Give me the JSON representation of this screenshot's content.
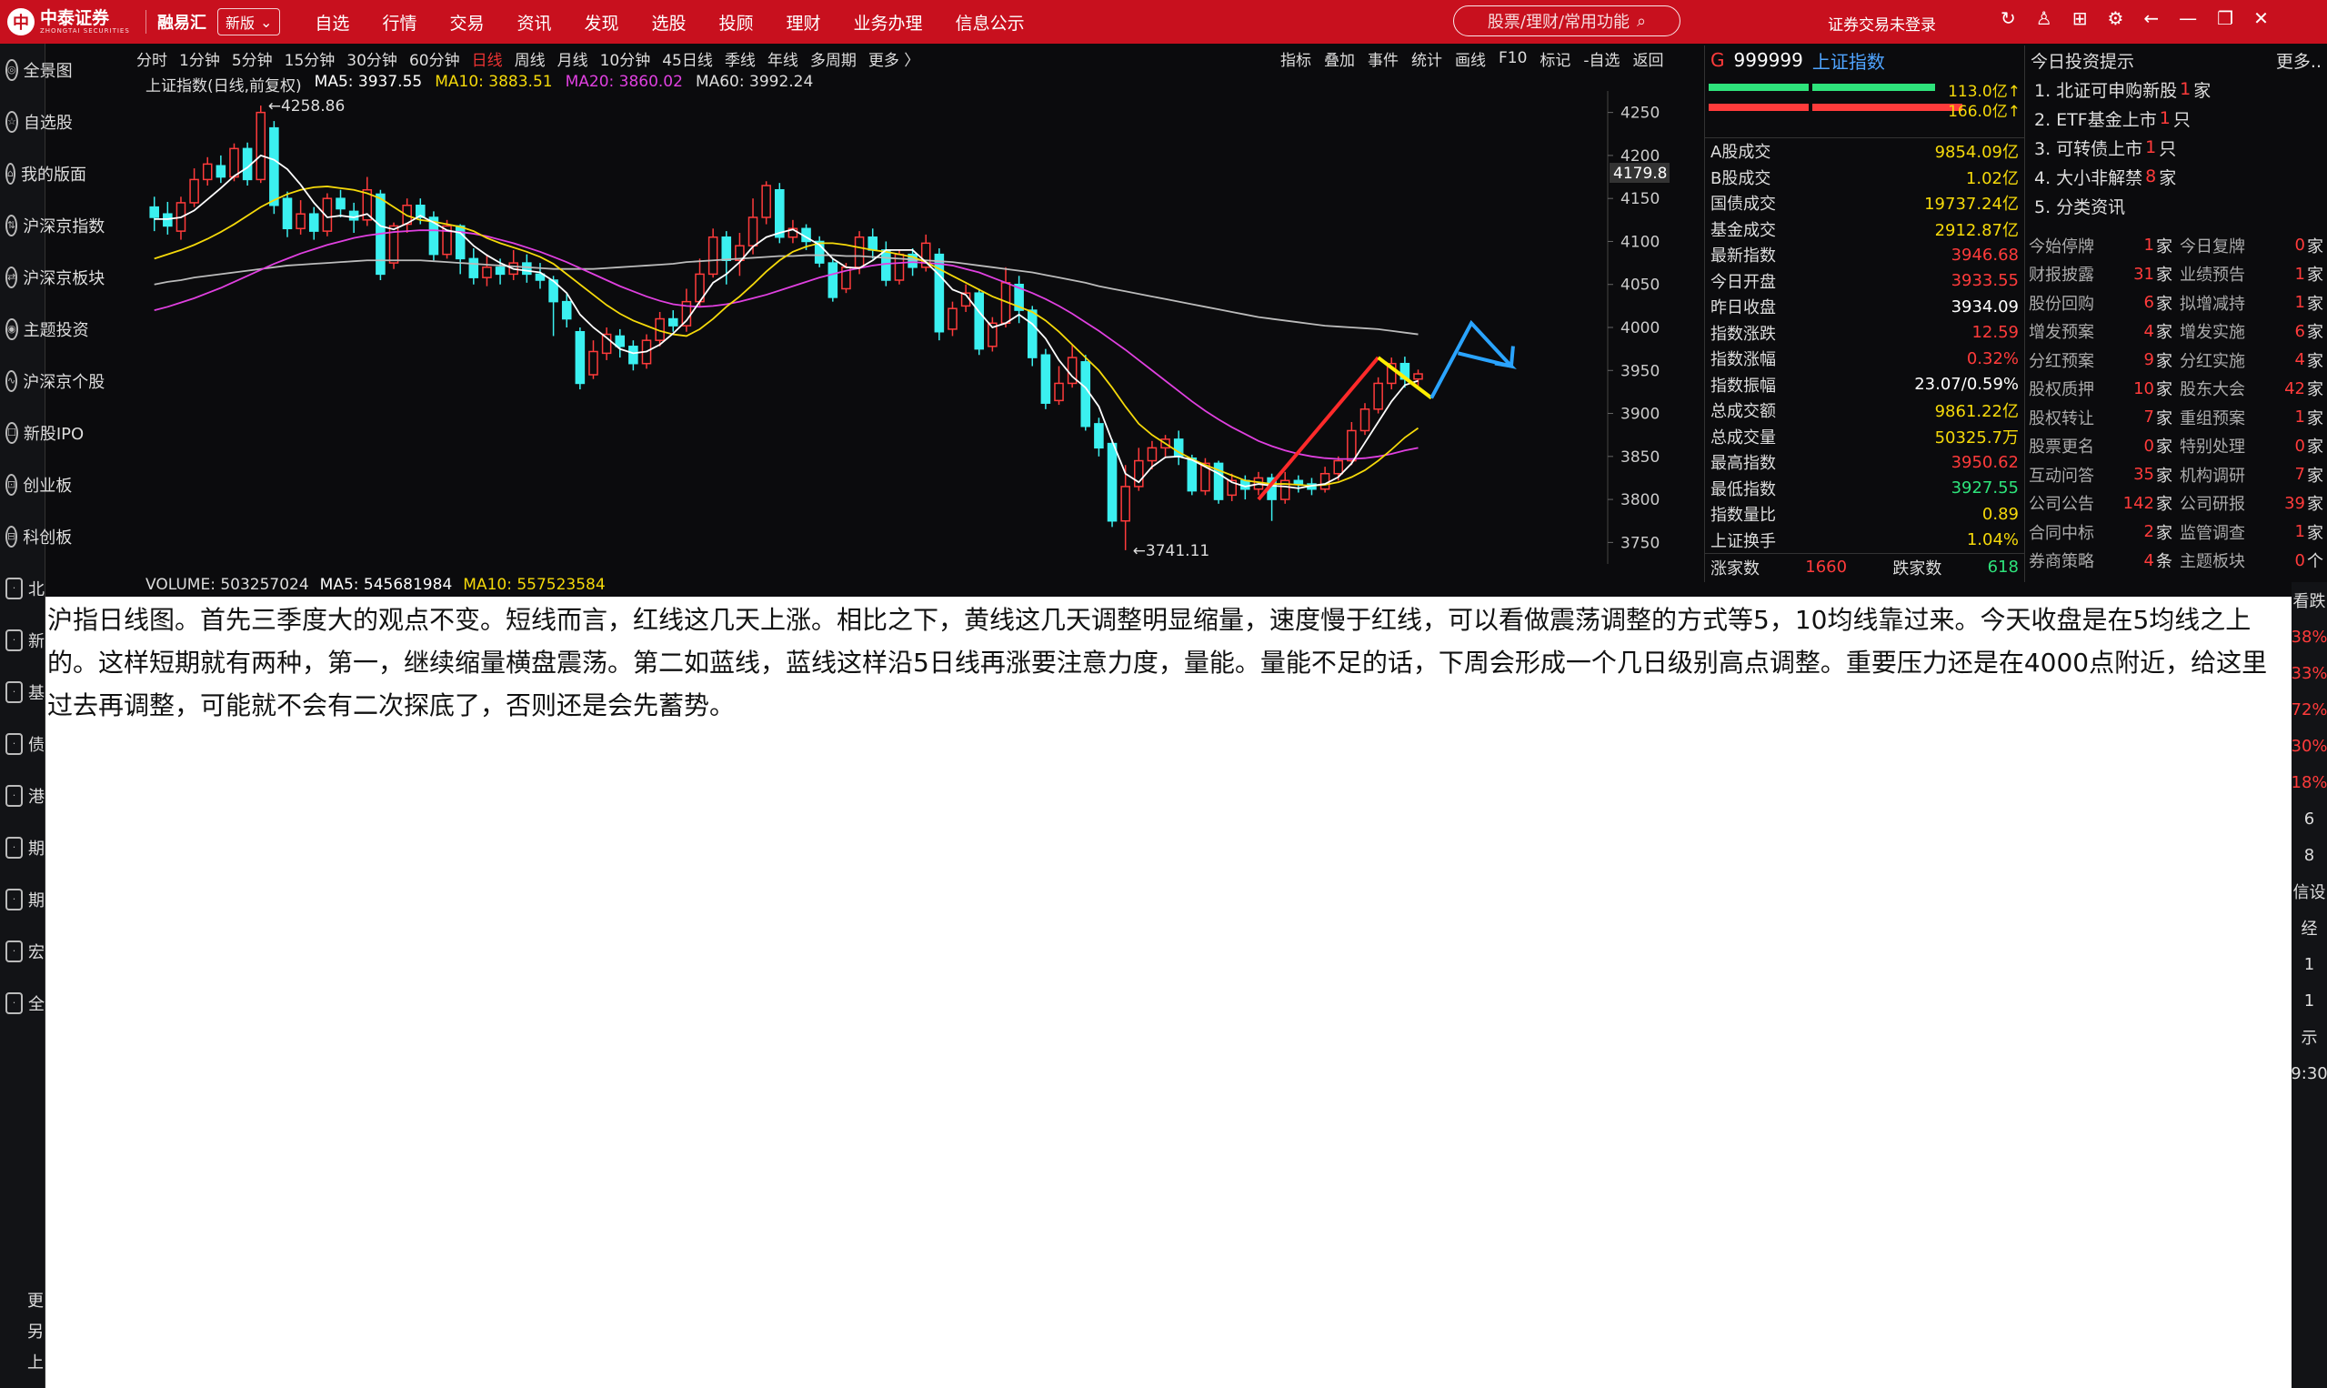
{
  "header": {
    "logo_mark": "中",
    "logo_name": "中泰证券",
    "logo_sub": "ZHONGTAI SECURITIES",
    "brand2": "融易汇",
    "version_label": "新版",
    "menu": [
      "自选",
      "行情",
      "交易",
      "资讯",
      "发现",
      "选股",
      "投顾",
      "理财",
      "业务办理",
      "信息公示"
    ],
    "search_placeholder": "股票/理财/常用功能",
    "login": "证券交易未登录",
    "accent": "#c8101e"
  },
  "sidebar": {
    "items": [
      "全景图",
      "自选股",
      "我的版面",
      "沪深京指数",
      "沪深京板块",
      "主题投资",
      "沪深京个股",
      "新股IPO",
      "创业板",
      "科创板"
    ],
    "extra": [
      "北",
      "新",
      "基",
      "债",
      "港",
      "期",
      "期",
      "宏",
      "全"
    ],
    "bottom": [
      "更",
      "另",
      "上"
    ]
  },
  "toolbar": {
    "periods": [
      "分时",
      "1分钟",
      "5分钟",
      "15分钟",
      "30分钟",
      "60分钟",
      "日线",
      "周线",
      "月线",
      "10分钟",
      "45日线",
      "季线",
      "年线",
      "多周期",
      "更多 〉"
    ],
    "active_period": "日线",
    "tools": [
      "指标",
      "叠加",
      "事件",
      "统计",
      "画线",
      "F10",
      "标记",
      "-自选",
      "返回"
    ]
  },
  "chart_title": {
    "name": "上证指数(日线,前复权)",
    "ma5": "MA5: 3937.55",
    "ma10": "MA10: 3883.51",
    "ma20": "MA20: 3860.02",
    "ma60": "MA60: 3992.24"
  },
  "chart_data": {
    "type": "candlestick",
    "ylim": [
      3725,
      4275
    ],
    "yticks": [
      4250,
      4200,
      4150,
      4100,
      4050,
      4000,
      3950,
      3900,
      3850,
      3800,
      3750
    ],
    "price_marker": "4179.8",
    "high_label": "←4258.86",
    "low_label": "←3741.11",
    "candles": [
      [
        4140,
        4128,
        4152,
        4112
      ],
      [
        4132,
        4118,
        4146,
        4108
      ],
      [
        4112,
        4145,
        4152,
        4102
      ],
      [
        4145,
        4172,
        4185,
        4140
      ],
      [
        4172,
        4190,
        4198,
        4165
      ],
      [
        4188,
        4175,
        4200,
        4168
      ],
      [
        4175,
        4208,
        4214,
        4170
      ],
      [
        4208,
        4172,
        4215,
        4165
      ],
      [
        4172,
        4250,
        4258,
        4168
      ],
      [
        4232,
        4142,
        4240,
        4132
      ],
      [
        4150,
        4115,
        4158,
        4105
      ],
      [
        4115,
        4132,
        4148,
        4108
      ],
      [
        4132,
        4112,
        4140,
        4102
      ],
      [
        4112,
        4150,
        4156,
        4106
      ],
      [
        4150,
        4138,
        4160,
        4128
      ],
      [
        4135,
        4125,
        4145,
        4110
      ],
      [
        4125,
        4160,
        4175,
        4118
      ],
      [
        4155,
        4062,
        4160,
        4055
      ],
      [
        4075,
        4118,
        4122,
        4068
      ],
      [
        4120,
        4142,
        4150,
        4110
      ],
      [
        4142,
        4128,
        4150,
        4120
      ],
      [
        4128,
        4085,
        4135,
        4078
      ],
      [
        4085,
        4118,
        4125,
        4080
      ],
      [
        4118,
        4080,
        4120,
        4062
      ],
      [
        4080,
        4058,
        4092,
        4050
      ],
      [
        4058,
        4070,
        4085,
        4048
      ],
      [
        4070,
        4062,
        4080,
        4050
      ],
      [
        4062,
        4075,
        4090,
        4055
      ],
      [
        4075,
        4062,
        4085,
        4052
      ],
      [
        4062,
        4055,
        4075,
        4045
      ],
      [
        4055,
        4030,
        4060,
        3990
      ],
      [
        4030,
        4010,
        4040,
        4000
      ],
      [
        3995,
        3935,
        4000,
        3928
      ],
      [
        3945,
        3972,
        3985,
        3940
      ],
      [
        3970,
        3992,
        4000,
        3962
      ],
      [
        3990,
        3978,
        3998,
        3965
      ],
      [
        3978,
        3958,
        3985,
        3950
      ],
      [
        3958,
        3985,
        3992,
        3952
      ],
      [
        3985,
        4010,
        4018,
        3978
      ],
      [
        4010,
        4002,
        4020,
        3995
      ],
      [
        4002,
        4030,
        4045,
        3995
      ],
      [
        4030,
        4062,
        4080,
        4025
      ],
      [
        4062,
        4105,
        4115,
        4058
      ],
      [
        4105,
        4078,
        4112,
        4050
      ],
      [
        4078,
        4095,
        4110,
        4060
      ],
      [
        4095,
        4128,
        4150,
        4085
      ],
      [
        4128,
        4165,
        4170,
        4120
      ],
      [
        4160,
        4105,
        4168,
        4098
      ],
      [
        4105,
        4115,
        4125,
        4098
      ],
      [
        4115,
        4100,
        4120,
        4090
      ],
      [
        4100,
        4075,
        4106,
        4070
      ],
      [
        4075,
        4035,
        4080,
        4030
      ],
      [
        4045,
        4070,
        4075,
        4040
      ],
      [
        4070,
        4105,
        4112,
        4062
      ],
      [
        4105,
        4090,
        4115,
        4080
      ],
      [
        4090,
        4055,
        4100,
        4048
      ],
      [
        4055,
        4085,
        4090,
        4050
      ],
      [
        4085,
        4070,
        4092,
        4060
      ],
      [
        4070,
        4098,
        4108,
        4065
      ],
      [
        4085,
        3995,
        4092,
        3985
      ],
      [
        3998,
        4022,
        4030,
        3990
      ],
      [
        4025,
        4040,
        4050,
        4018
      ],
      [
        4040,
        3975,
        4045,
        3968
      ],
      [
        3978,
        4005,
        4012,
        3972
      ],
      [
        4005,
        4052,
        4070,
        4000
      ],
      [
        4050,
        4020,
        4060,
        4005
      ],
      [
        4020,
        3965,
        4025,
        3955
      ],
      [
        3968,
        3912,
        3975,
        3905
      ],
      [
        3915,
        3935,
        3955,
        3910
      ],
      [
        3935,
        3965,
        3980,
        3930
      ],
      [
        3960,
        3885,
        3968,
        3880
      ],
      [
        3888,
        3860,
        3895,
        3850
      ],
      [
        3865,
        3775,
        3870,
        3768
      ],
      [
        3775,
        3815,
        3840,
        3741
      ],
      [
        3815,
        3845,
        3860,
        3810
      ],
      [
        3845,
        3860,
        3868,
        3835
      ],
      [
        3860,
        3870,
        3875,
        3850
      ],
      [
        3870,
        3850,
        3880,
        3840
      ],
      [
        3848,
        3810,
        3852,
        3805
      ],
      [
        3810,
        3842,
        3848,
        3805
      ],
      [
        3842,
        3800,
        3845,
        3795
      ],
      [
        3805,
        3822,
        3830,
        3798
      ],
      [
        3822,
        3812,
        3828,
        3800
      ],
      [
        3812,
        3825,
        3832,
        3805
      ],
      [
        3825,
        3800,
        3830,
        3775
      ],
      [
        3800,
        3822,
        3832,
        3795
      ],
      [
        3822,
        3818,
        3828,
        3808
      ],
      [
        3818,
        3812,
        3825,
        3805
      ],
      [
        3812,
        3830,
        3838,
        3808
      ],
      [
        3830,
        3845,
        3850,
        3822
      ],
      [
        3845,
        3880,
        3890,
        3840
      ],
      [
        3880,
        3905,
        3912,
        3875
      ],
      [
        3905,
        3935,
        3942,
        3900
      ],
      [
        3935,
        3958,
        3965,
        3928
      ],
      [
        3958,
        3940,
        3966,
        3930
      ],
      [
        3940,
        3946,
        3951,
        3928
      ]
    ],
    "ma5": [
      4126,
      4126,
      4128,
      4136,
      4149,
      4162,
      4176,
      4186,
      4200,
      4195,
      4184,
      4166,
      4145,
      4128,
      4130,
      4128,
      4132,
      4118,
      4114,
      4121,
      4130,
      4122,
      4113,
      4110,
      4095,
      4084,
      4075,
      4068,
      4066,
      4064,
      4054,
      4040,
      4015,
      4000,
      3988,
      3975,
      3970,
      3972,
      3980,
      3993,
      4008,
      4030,
      4052,
      4062,
      4076,
      4094,
      4105,
      4110,
      4114,
      4105,
      4096,
      4080,
      4070,
      4069,
      4078,
      4090,
      4090,
      4090,
      4076,
      4061,
      4044,
      4038,
      4018,
      4000,
      4005,
      4015,
      4004,
      3987,
      3962,
      3943,
      3930,
      3908,
      3868,
      3830,
      3820,
      3838,
      3849,
      3850,
      3846,
      3838,
      3830,
      3820,
      3815,
      3818,
      3816,
      3815,
      3813,
      3816,
      3818,
      3826,
      3842,
      3866,
      3890,
      3914,
      3933,
      3938
    ],
    "ma10": [
      4080,
      4085,
      4090,
      4096,
      4103,
      4111,
      4120,
      4130,
      4140,
      4148,
      4155,
      4160,
      4163,
      4164,
      4162,
      4160,
      4156,
      4150,
      4140,
      4130,
      4125,
      4123,
      4120,
      4117,
      4112,
      4104,
      4098,
      4093,
      4088,
      4082,
      4074,
      4062,
      4050,
      4038,
      4026,
      4016,
      4008,
      4002,
      3996,
      3992,
      3990,
      3998,
      4010,
      4024,
      4036,
      4050,
      4065,
      4078,
      4088,
      4094,
      4098,
      4098,
      4096,
      4093,
      4090,
      4088,
      4085,
      4082,
      4076,
      4068,
      4060,
      4052,
      4044,
      4036,
      4030,
      4024,
      4018,
      4008,
      3995,
      3980,
      3965,
      3950,
      3930,
      3908,
      3888,
      3875,
      3865,
      3855,
      3847,
      3840,
      3834,
      3828,
      3822,
      3820,
      3818,
      3818,
      3817,
      3816,
      3817,
      3820,
      3826,
      3834,
      3845,
      3858,
      3872,
      3883
    ],
    "ma20": [
      4020,
      4024,
      4029,
      4034,
      4040,
      4046,
      4053,
      4060,
      4067,
      4074,
      4080,
      4086,
      4091,
      4096,
      4100,
      4104,
      4107,
      4109,
      4111,
      4112,
      4113,
      4113,
      4112,
      4111,
      4109,
      4106,
      4102,
      4098,
      4093,
      4088,
      4082,
      4076,
      4069,
      4062,
      4055,
      4048,
      4042,
      4036,
      4031,
      4027,
      4025,
      4024,
      4025,
      4027,
      4030,
      4034,
      4038,
      4043,
      4048,
      4053,
      4058,
      4062,
      4066,
      4069,
      4072,
      4074,
      4075,
      4076,
      4075,
      4074,
      4072,
      4068,
      4064,
      4058,
      4052,
      4046,
      4040,
      4033,
      4025,
      4016,
      4006,
      3996,
      3985,
      3974,
      3962,
      3950,
      3938,
      3926,
      3914,
      3903,
      3893,
      3884,
      3876,
      3868,
      3862,
      3857,
      3853,
      3850,
      3848,
      3847,
      3847,
      3848,
      3850,
      3853,
      3857,
      3860
    ],
    "ma60": [
      4050,
      4053,
      4055,
      4058,
      4060,
      4062,
      4064,
      4066,
      4068,
      4070,
      4072,
      4073,
      4074,
      4075,
      4076,
      4077,
      4078,
      4078,
      4078,
      4078,
      4078,
      4077,
      4076,
      4075,
      4074,
      4073,
      4072,
      4071,
      4070,
      4069,
      4068,
      4068,
      4068,
      4068,
      4069,
      4070,
      4071,
      4072,
      4073,
      4074,
      4076,
      4077,
      4078,
      4079,
      4080,
      4081,
      4082,
      4083,
      4083,
      4084,
      4084,
      4084,
      4083,
      4083,
      4082,
      4081,
      4080,
      4079,
      4078,
      4077,
      4076,
      4074,
      4072,
      4070,
      4068,
      4066,
      4064,
      4061,
      4058,
      4055,
      4052,
      4048,
      4045,
      4042,
      4039,
      4036,
      4033,
      4030,
      4027,
      4024,
      4021,
      4018,
      4015,
      4012,
      4010,
      4008,
      4006,
      4004,
      4002,
      4001,
      4000,
      3999,
      3998,
      3996,
      3994,
      3992
    ],
    "annotations": {
      "red_trend": [
        [
          83,
          3800
        ],
        [
          92,
          3965
        ]
      ],
      "yellow_trend": [
        [
          92,
          3965
        ],
        [
          96,
          3918
        ]
      ],
      "blue_path": [
        [
          96,
          3918
        ],
        [
          99,
          4005
        ],
        [
          102,
          3955
        ],
        [
          98,
          3970
        ]
      ]
    },
    "colors": {
      "up": "#ff3b3b",
      "down": "#3bf0f0",
      "ma5": "#ffffff",
      "ma10": "#f5d90a",
      "ma20": "#e040e0",
      "ma60": "#bbbbbb",
      "red_trend": "#ff2a2a",
      "yellow_trend": "#ffee00",
      "blue_path": "#2aa4ff"
    }
  },
  "volume": {
    "label": "VOLUME: 503257024",
    "ma5": "MA5: 545681984",
    "ma10": "MA10: 557523584"
  },
  "quote": {
    "flag": "G",
    "code": "999999",
    "name": "上证指数",
    "bar_vals": [
      "113.0亿↑",
      "166.0亿↑"
    ],
    "rows": [
      {
        "label": "A股成交",
        "value": "9854.09亿",
        "cls": ""
      },
      {
        "label": "B股成交",
        "value": "1.02亿",
        "cls": ""
      },
      {
        "label": "国债成交",
        "value": "19737.24亿",
        "cls": ""
      },
      {
        "label": "基金成交",
        "value": "2912.87亿",
        "cls": ""
      },
      {
        "label": "最新指数",
        "value": "3946.68",
        "cls": "red"
      },
      {
        "label": "今日开盘",
        "value": "3933.55",
        "cls": "red"
      },
      {
        "label": "昨日收盘",
        "value": "3934.09",
        "cls": "white"
      },
      {
        "label": "指数涨跌",
        "value": "12.59",
        "cls": "red"
      },
      {
        "label": "指数涨幅",
        "value": "0.32%",
        "cls": "red"
      },
      {
        "label": "指数振幅",
        "value": "23.07/0.59%",
        "cls": "white"
      },
      {
        "label": "总成交额",
        "value": "9861.22亿",
        "cls": ""
      },
      {
        "label": "总成交量",
        "value": "50325.7万",
        "cls": ""
      },
      {
        "label": "最高指数",
        "value": "3950.62",
        "cls": "red"
      },
      {
        "label": "最低指数",
        "value": "3927.55",
        "cls": "green"
      },
      {
        "label": "指数量比",
        "value": "0.89",
        "cls": ""
      },
      {
        "label": "上证换手",
        "value": "1.04%",
        "cls": ""
      }
    ],
    "rise_label": "涨家数",
    "rise_value": "1660",
    "fall_label": "跌家数",
    "fall_value": "618"
  },
  "tips": {
    "title": "今日投资提示",
    "more": "更多..",
    "items": [
      {
        "pre": "1. 北证可申购新股",
        "num": "1",
        "post": "家"
      },
      {
        "pre": "2. ETF基金上市",
        "num": "1",
        "post": "只"
      },
      {
        "pre": "3. 可转债上市",
        "num": "1",
        "post": "只"
      },
      {
        "pre": "4. 大小非解禁",
        "num": "8",
        "post": "家"
      },
      {
        "pre": "5. 分类资讯",
        "num": "",
        "post": ""
      }
    ],
    "grid": [
      [
        [
          "今始停牌",
          "1",
          "家"
        ],
        [
          "今日复牌",
          "0",
          "家"
        ]
      ],
      [
        [
          "财报披露",
          "31",
          "家"
        ],
        [
          "业绩预告",
          "1",
          "家"
        ]
      ],
      [
        [
          "股份回购",
          "6",
          "家"
        ],
        [
          "拟增减持",
          "1",
          "家"
        ]
      ],
      [
        [
          "增发预案",
          "4",
          "家"
        ],
        [
          "增发实施",
          "6",
          "家"
        ]
      ],
      [
        [
          "分红预案",
          "9",
          "家"
        ],
        [
          "分红实施",
          "4",
          "家"
        ]
      ],
      [
        [
          "股权质押",
          "10",
          "家"
        ],
        [
          "股东大会",
          "42",
          "家"
        ]
      ],
      [
        [
          "股权转让",
          "7",
          "家"
        ],
        [
          "重组预案",
          "1",
          "家"
        ]
      ],
      [
        [
          "股票更名",
          "0",
          "家"
        ],
        [
          "特别处理",
          "0",
          "家"
        ]
      ],
      [
        [
          "互动问答",
          "35",
          "家"
        ],
        [
          "机构调研",
          "7",
          "家"
        ]
      ],
      [
        [
          "公司公告",
          "142",
          "家"
        ],
        [
          "公司研报",
          "39",
          "家"
        ]
      ],
      [
        [
          "合同中标",
          "2",
          "家"
        ],
        [
          "监管调查",
          "1",
          "家"
        ]
      ],
      [
        [
          "券商策略",
          "4",
          "条"
        ],
        [
          "主题板块",
          "0",
          "个"
        ]
      ]
    ]
  },
  "note": {
    "text": "沪指日线图。首先三季度大的观点不变。短线而言，红线这几天上涨。相比之下，黄线这几天调整明显缩量，速度慢于红线，可以看做震荡调整的方式等5，10均线靠过来。今天收盘是在5均线之上的。这样短期就有两种，第一，继续缩量横盘震荡。第二如蓝线，蓝线这样沿5日线再涨要注意力度，量能。量能不足的话，下周会形成一个几日级别高点调整。重要压力还是在4000点附近，给这里过去再调整，可能就不会有二次探底了，否则还是会先蓄势。"
  },
  "right_edge": [
    "看跌",
    "38%",
    "33%",
    "72%",
    "30%",
    "18%",
    "6",
    "8",
    "信设",
    "经",
    "1",
    "1",
    "示",
    "9:30"
  ]
}
